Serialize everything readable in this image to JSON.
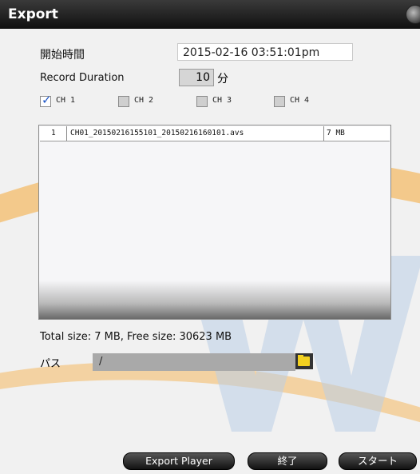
{
  "window": {
    "title": "Export"
  },
  "form": {
    "start_time_label": "開始時間",
    "start_time_value": "2015-02-16 03:51:01pm",
    "duration_label": "Record Duration",
    "duration_value": "10",
    "duration_unit": "分"
  },
  "channels": [
    {
      "label": "CH 1",
      "checked": true
    },
    {
      "label": "CH 2",
      "checked": false
    },
    {
      "label": "CH 3",
      "checked": false
    },
    {
      "label": "CH 4",
      "checked": false
    }
  ],
  "files": [
    {
      "index": "1",
      "name": "CH01_20150216155101_20150216160101.avs",
      "size": "7 MB"
    }
  ],
  "summary": {
    "text": "Total size: 7 MB, Free size: 30623 MB"
  },
  "path": {
    "label": "パス",
    "value": "/"
  },
  "buttons": {
    "export_player": "Export Player",
    "close": "終了",
    "start": "スタート"
  },
  "colors": {
    "watermark_orange": "#f4b860",
    "watermark_blue": "#b9cee6",
    "check_blue": "#1f57c7"
  }
}
